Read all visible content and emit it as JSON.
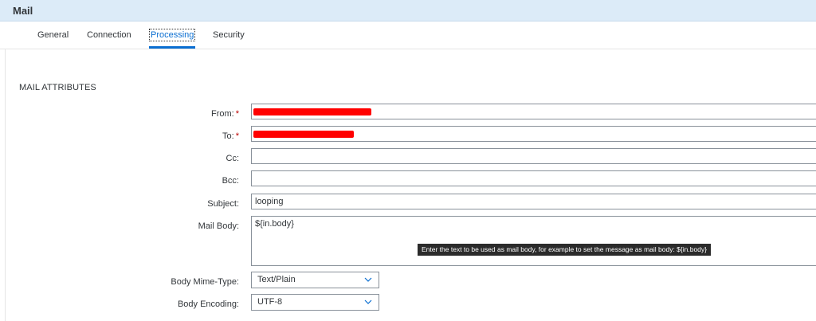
{
  "window": {
    "title": "Mail"
  },
  "tabs": [
    {
      "label": "General"
    },
    {
      "label": "Connection"
    },
    {
      "label": "Processing"
    },
    {
      "label": "Security"
    }
  ],
  "active_tab": "Processing",
  "section": {
    "title": "MAIL ATTRIBUTES"
  },
  "fields": {
    "from": {
      "label": "From:",
      "value": ""
    },
    "to": {
      "label": "To:",
      "value": ""
    },
    "cc": {
      "label": "Cc:",
      "value": ""
    },
    "bcc": {
      "label": "Bcc:",
      "value": ""
    },
    "subject": {
      "label": "Subject:",
      "value": "looping"
    },
    "mail_body": {
      "label": "Mail Body:",
      "value": "${in.body}",
      "tooltip": "Enter the text to be used as mail body, for example to set the message as mail body: ${in.body}"
    },
    "body_mime_type": {
      "label": "Body Mime-Type:",
      "value": "Text/Plain"
    },
    "body_encoding": {
      "label": "Body Encoding:",
      "value": "UTF-8"
    }
  },
  "required_marker": "*",
  "colors": {
    "title_bar": "#dcebf8",
    "accent": "#0a6ed1",
    "required": "#bb0000",
    "redaction": "#ff0000",
    "tooltip_bg": "#2b2b2b"
  }
}
